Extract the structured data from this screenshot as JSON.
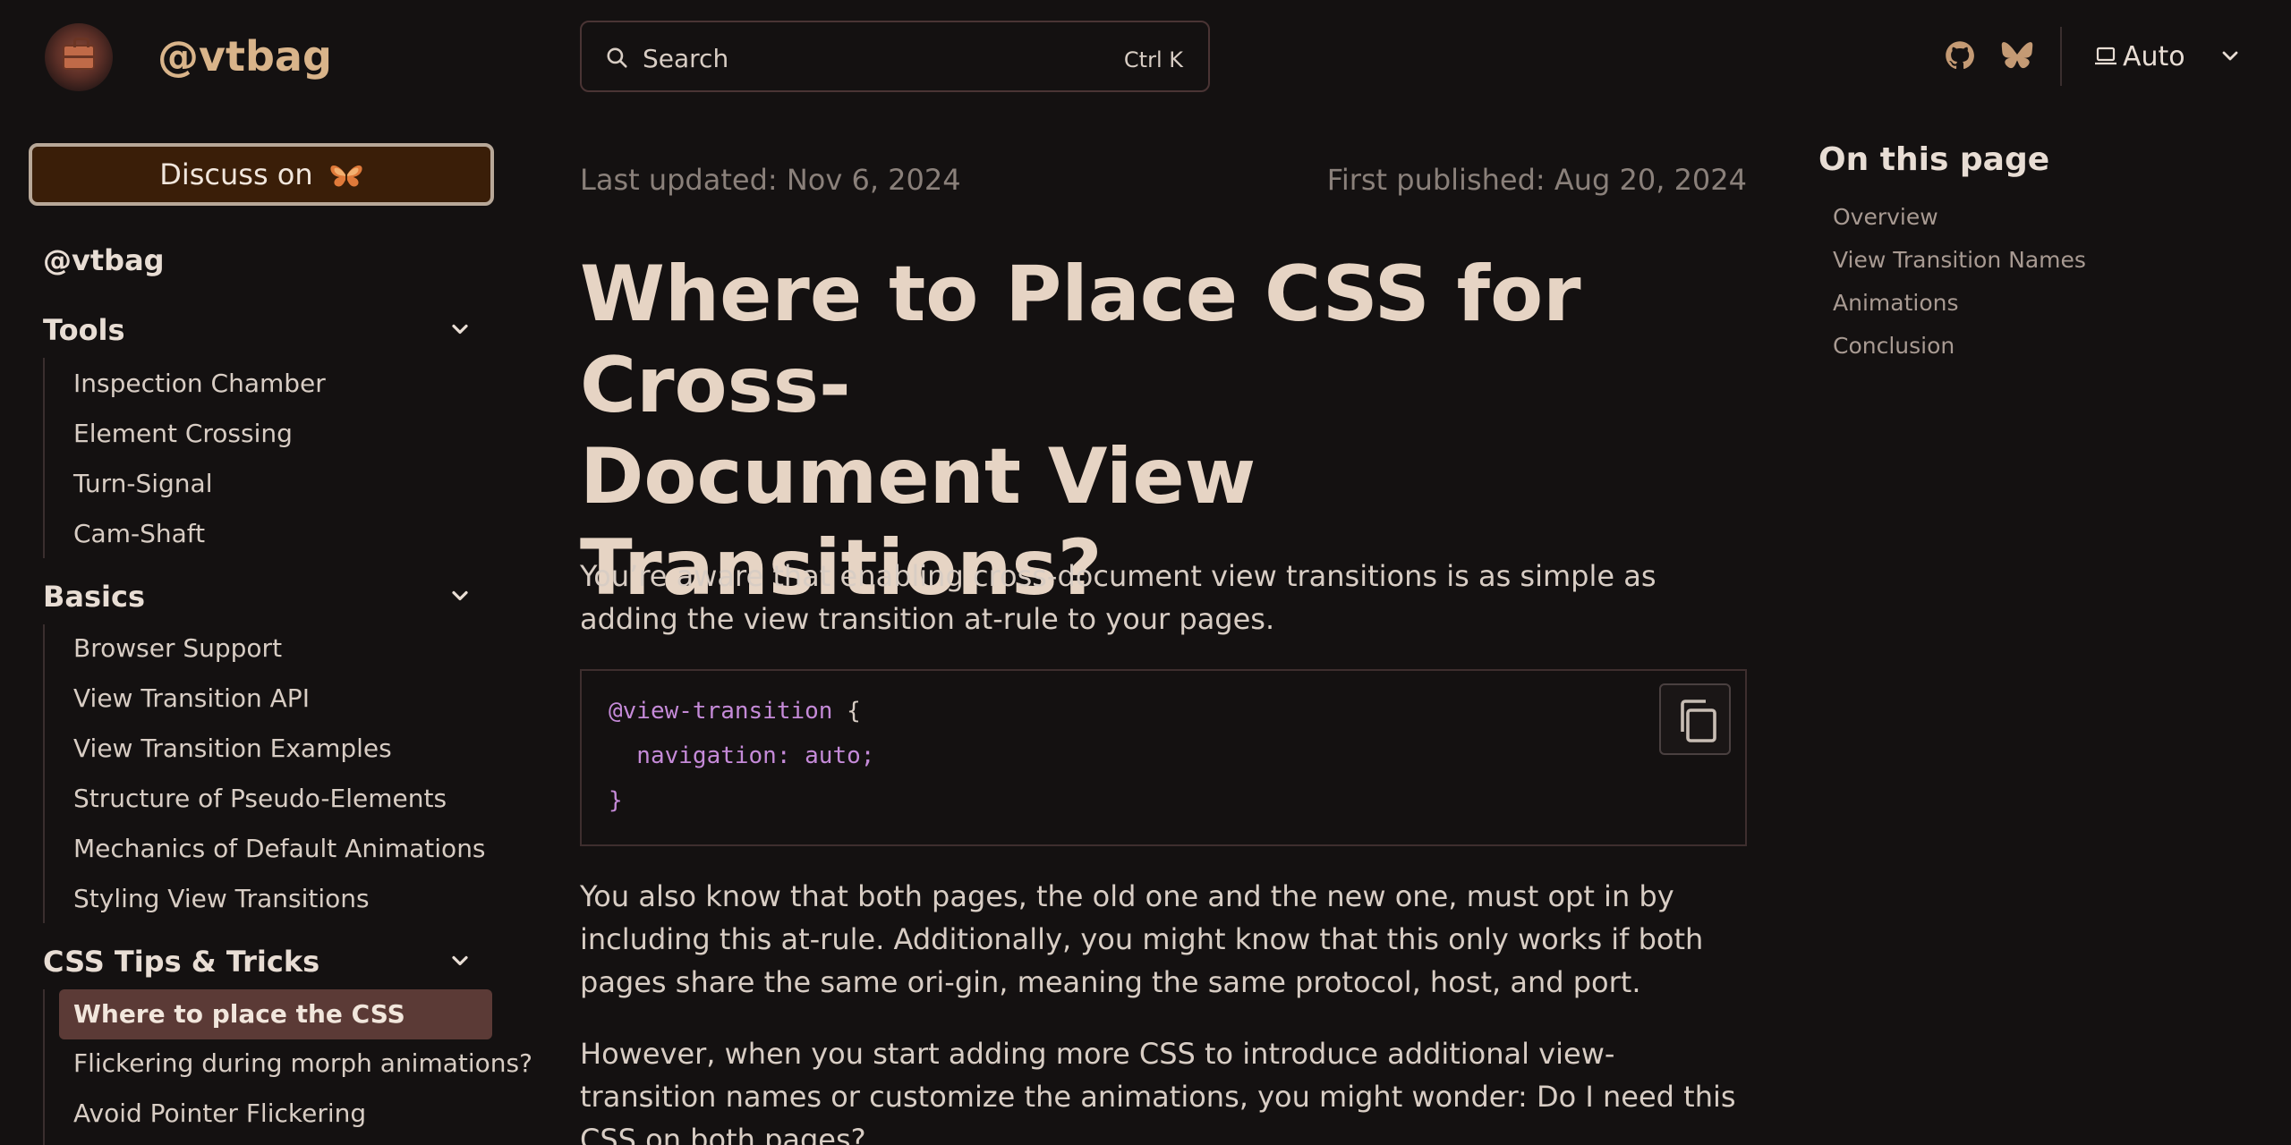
{
  "header": {
    "site_title": "@vtbag",
    "search": {
      "label": "Search",
      "shortcut": "Ctrl K"
    },
    "theme": {
      "label": "Auto"
    },
    "icons": [
      "github-icon",
      "bluesky-icon",
      "laptop-icon",
      "chevron-down-icon"
    ]
  },
  "sidebar": {
    "discuss_label": "Discuss on",
    "root": "@vtbag",
    "groups": [
      {
        "title": "Tools",
        "items": [
          "Inspection Chamber",
          "Element Crossing",
          "Turn-Signal",
          "Cam-Shaft"
        ]
      },
      {
        "title": "Basics",
        "items": [
          "Browser Support",
          "View Transition API",
          "View Transition Examples",
          "Structure of Pseudo-Elements",
          "Mechanics of Default Animations",
          "Styling View Transitions"
        ]
      },
      {
        "title": "CSS Tips & Tricks",
        "items": [
          "Where to place the CSS",
          "Flickering during morph animations?",
          "Avoid Pointer Flickering"
        ]
      }
    ],
    "active_item": "Where to place the CSS"
  },
  "main": {
    "last_updated": "Last updated: Nov 6, 2024",
    "first_published": "First published: Aug 20, 2024",
    "title_line1": "Where to Place CSS for Cross-",
    "title_line2": "Document View Transitions?",
    "para1": "You’re aware that enabling cross-document view transitions is as simple as adding the view transition at-rule to your pages.",
    "code": {
      "line1_kw": "@view-transition",
      "line1_pn": " {",
      "line2_kw": "  navigation: auto;",
      "line3": "}"
    },
    "para2": "You also know that both pages, the old one and the new one, must opt in by including this at-rule. Additionally, you might know that this only works if both pages share the same ori-gin, meaning the same protocol, host, and port.",
    "para3": "However, when you start adding more CSS to introduce additional view-transition names or customize the animations, you might wonder: Do I need this CSS on both pages?"
  },
  "toc": {
    "title": "On this page",
    "items": [
      "Overview",
      "View Transition Names",
      "Animations",
      "Conclusion"
    ]
  },
  "colors": {
    "background": "#141111",
    "accent": "#d9b48a",
    "discuss_bg": "#3a1e08",
    "active_item_bg": "#5b3a36",
    "code_keyword": "#c58ad8"
  }
}
